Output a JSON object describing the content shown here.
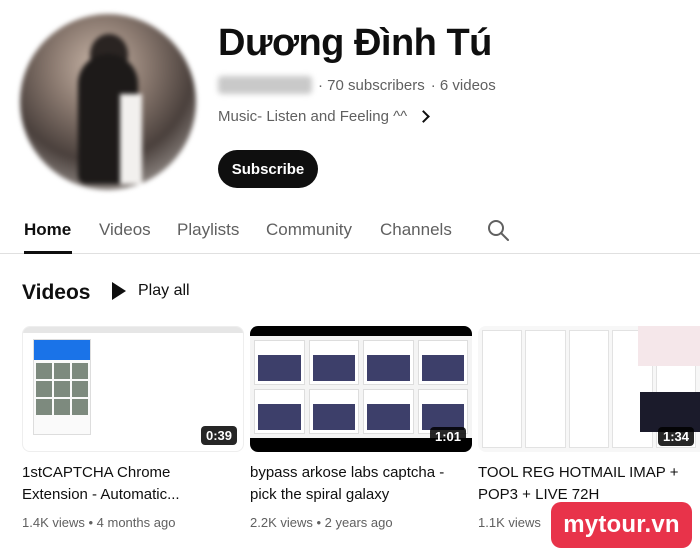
{
  "channel": {
    "name": "Dương Đình Tú",
    "subscribers": "· 70 subscribers",
    "videos_count": "· 6 videos",
    "about": "Music- Listen and Feeling ^^",
    "subscribe_label": "Subscribe"
  },
  "tabs": [
    {
      "label": "Home",
      "active": true
    },
    {
      "label": "Videos"
    },
    {
      "label": "Playlists"
    },
    {
      "label": "Community"
    },
    {
      "label": "Channels"
    }
  ],
  "section": {
    "title": "Videos",
    "play_all": "Play all"
  },
  "videos": [
    {
      "title": "1stCAPTCHA Chrome Extension - Automatic...",
      "duration": "0:39",
      "views": "1.4K views",
      "age": "4 months ago"
    },
    {
      "title": "bypass arkose labs captcha - pick the spiral galaxy",
      "duration": "1:01",
      "views": "2.2K views",
      "age": "2 years ago"
    },
    {
      "title": "TOOL REG HOTMAIL IMAP + POP3 + LIVE 72H",
      "duration": "1:34",
      "views": "1.1K views",
      "age": ""
    }
  ],
  "watermark": "mytour.vn",
  "icons": {
    "search": "search-icon",
    "play": "play-icon",
    "chevron": "chevron-right-icon"
  },
  "colors": {
    "subscribe_bg": "#0f0f0f",
    "watermark_bg": "#e8334a",
    "meta_text": "#606060"
  }
}
